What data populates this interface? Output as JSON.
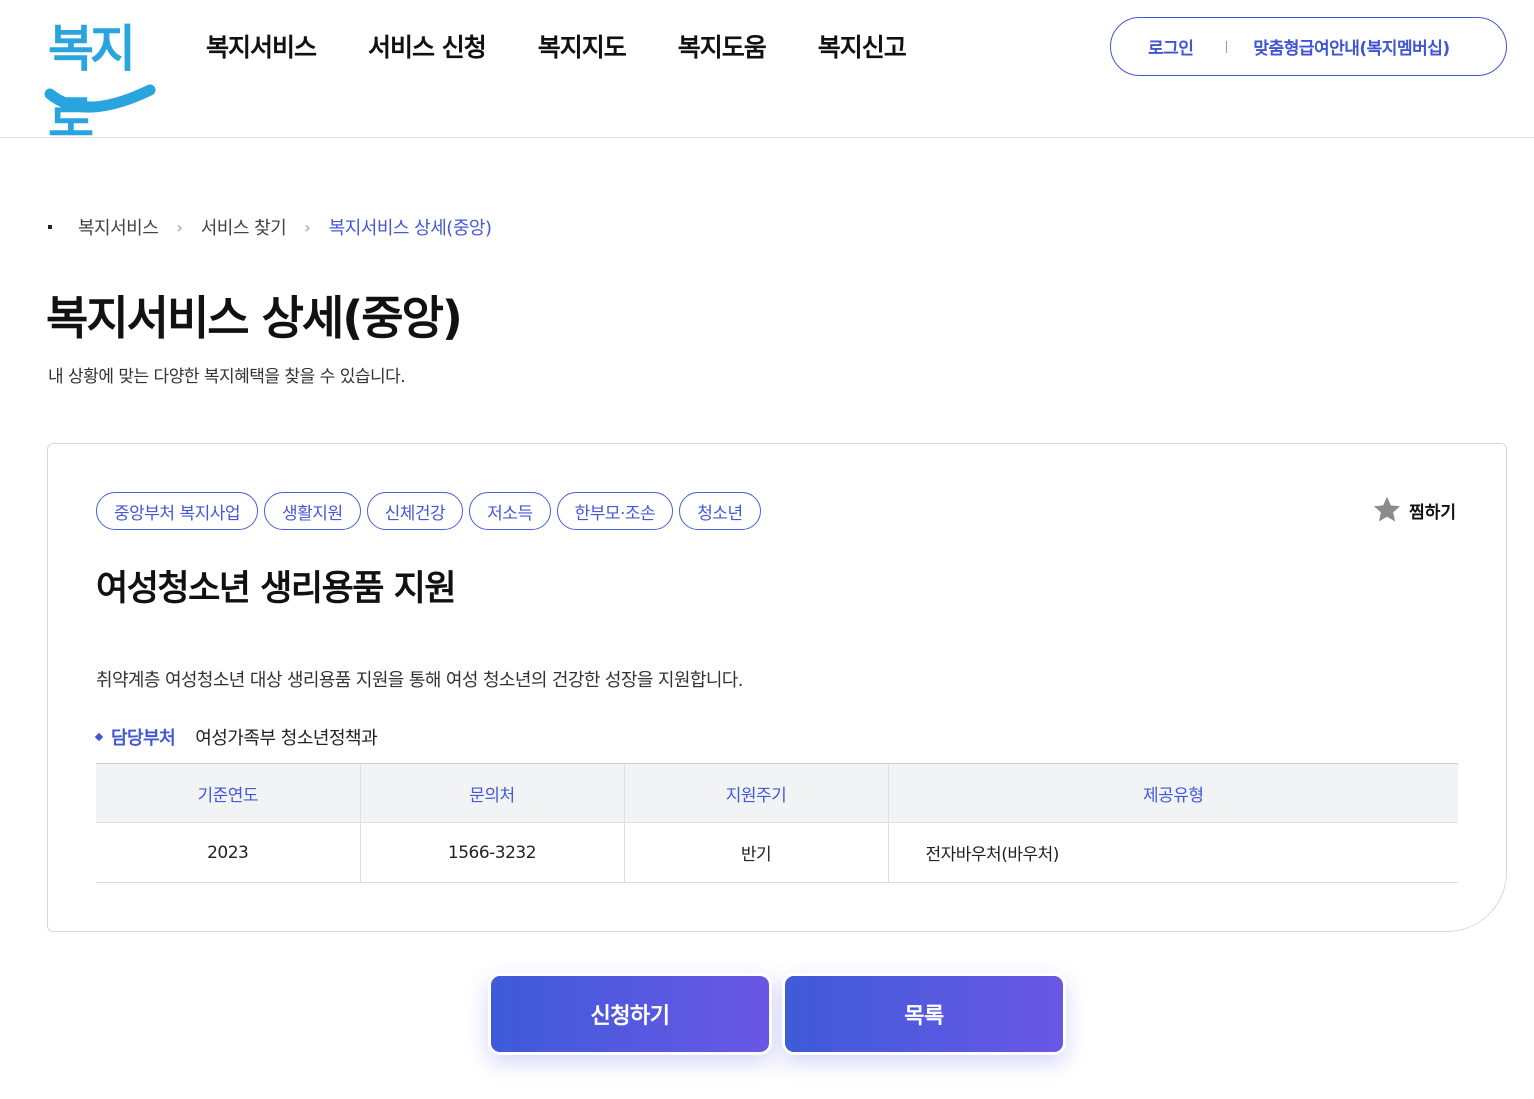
{
  "header": {
    "logo_text": "복지로",
    "nav": [
      "복지서비스",
      "서비스 신청",
      "복지지도",
      "복지도움",
      "복지신고"
    ],
    "util": {
      "login_label": "로그인",
      "membership_label": "맞춤형급여안내(복지멤버십)"
    }
  },
  "breadcrumb": [
    "복지서비스",
    "서비스 찾기",
    "복지서비스 상세(중앙)"
  ],
  "page": {
    "title": "복지서비스 상세(중앙)",
    "description": "내 상황에 맞는 다양한 복지혜택을 찾을 수 있습니다."
  },
  "service": {
    "tags": [
      "중앙부처 복지사업",
      "생활지원",
      "신체건강",
      "저소득",
      "한부모·조손",
      "청소년"
    ],
    "favorite_label": "찜하기",
    "title": "여성청소년 생리용품 지원",
    "description": "취약계층 여성청소년 대상 생리용품 지원을 통해 여성 청소년의 건강한 성장을 지원합니다.",
    "dept_label": "담당부처",
    "dept_value": "여성가족부 청소년정책과",
    "table": {
      "headers": [
        "기준연도",
        "문의처",
        "지원주기",
        "제공유형"
      ],
      "row": [
        "2023",
        "1566-3232",
        "반기",
        "전자바우처(바우처)"
      ]
    }
  },
  "buttons": {
    "apply_label": "신청하기",
    "list_label": "목록"
  },
  "colors": {
    "accent": "#4458d6",
    "logo": "#2aa4de",
    "button_start": "#3e5bd8",
    "button_end": "#6a57e6"
  }
}
